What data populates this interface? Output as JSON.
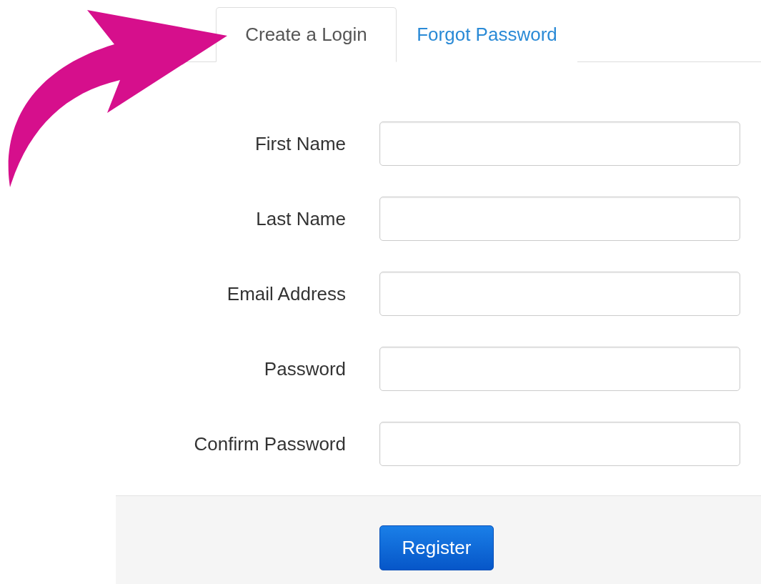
{
  "tabs": [
    {
      "label": "Create a Login",
      "selected": true
    },
    {
      "label": "Forgot Password",
      "selected": false
    }
  ],
  "fields": [
    {
      "label": "First Name"
    },
    {
      "label": "Last Name"
    },
    {
      "label": "Email Address"
    },
    {
      "label": "Password"
    },
    {
      "label": "Confirm Password"
    }
  ],
  "submit_button": {
    "label": "Register"
  }
}
